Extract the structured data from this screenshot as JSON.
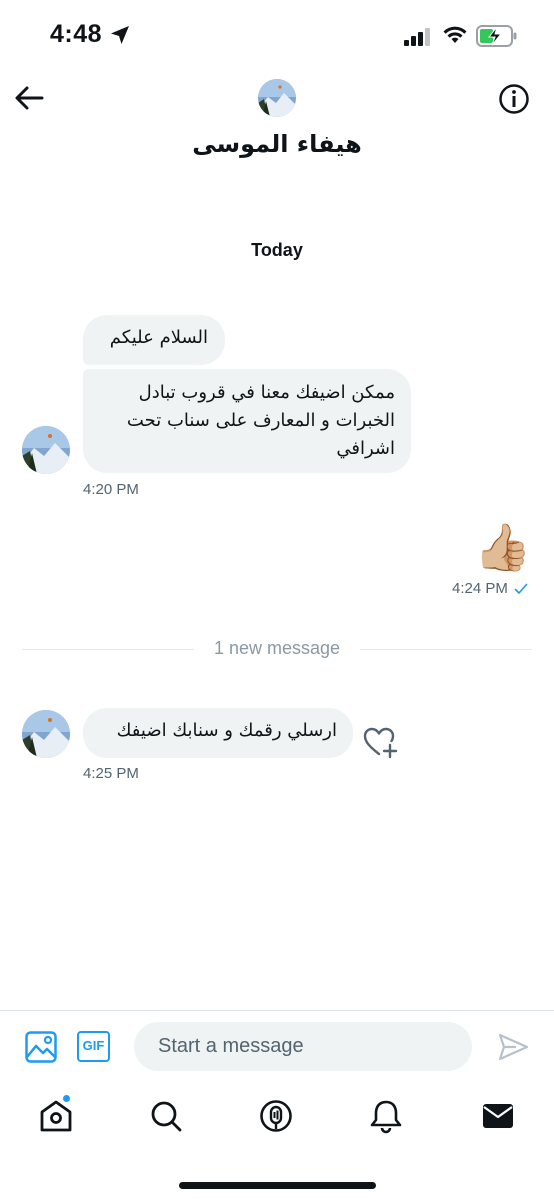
{
  "status_bar": {
    "time": "4:48",
    "icons": [
      "location-arrow-icon",
      "signal-icon",
      "wifi-icon",
      "battery-charging-icon"
    ]
  },
  "header": {
    "contact_name": "هيفاء الموسى",
    "back_icon": "arrow-left-icon",
    "info_icon": "info-icon"
  },
  "conversation": {
    "date_separator": "Today",
    "messages": [
      {
        "direction": "incoming",
        "text": "السلام عليكم"
      },
      {
        "direction": "incoming",
        "text": "ممكن اضيفك معنا في قروب تبادل الخبرات و المعارف على سناب تحت اشرافي"
      },
      {
        "direction": "incoming",
        "time": "4:20 PM"
      },
      {
        "direction": "outgoing",
        "text": "👍🏼",
        "time": "4:24 PM",
        "status": "read"
      },
      {
        "direction": "incoming",
        "text": "ارسلي رقمك و سنابك اضيفك",
        "time": "4:25 PM"
      }
    ],
    "new_message_divider": "1 new message"
  },
  "composer": {
    "placeholder": "Start a message",
    "gif_label": "GIF"
  },
  "bottom_nav": {
    "items": [
      "home-icon",
      "search-icon",
      "spaces-icon",
      "notifications-icon",
      "messages-icon"
    ],
    "active": "messages-icon"
  },
  "colors": {
    "accent": "#1d9bf0",
    "bubble_bg": "#eff3f4",
    "muted_text": "#536471"
  }
}
